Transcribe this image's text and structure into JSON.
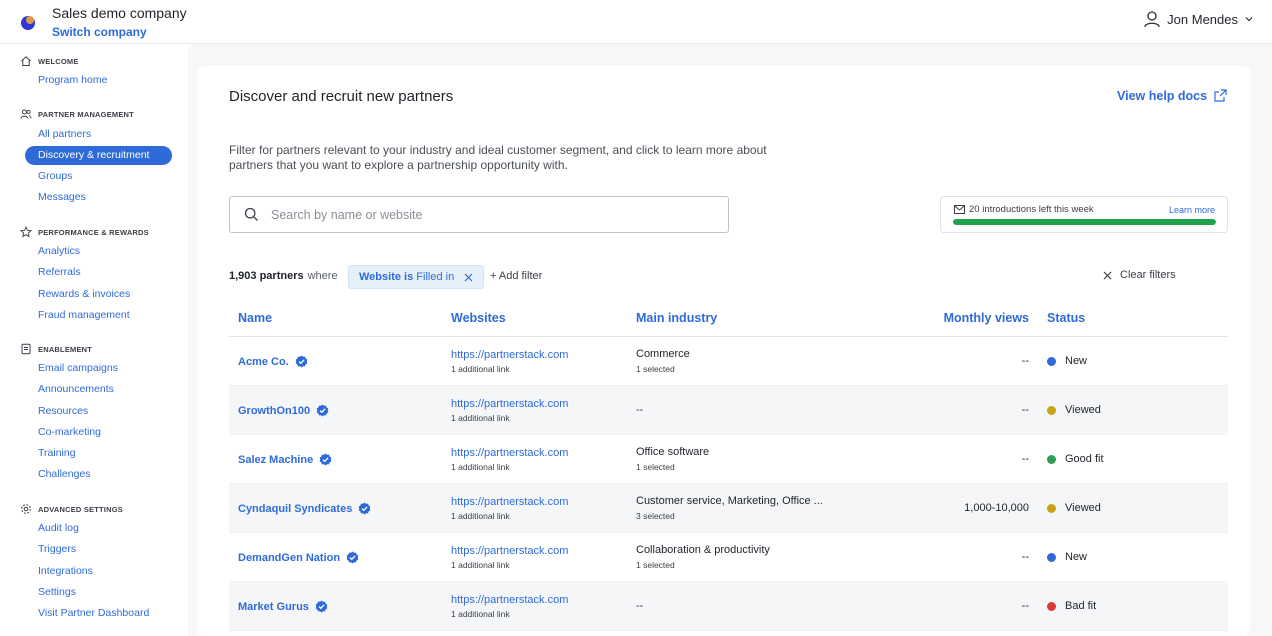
{
  "topbar": {
    "company": "Sales demo company",
    "switch_label": "Switch company",
    "user_name": "Jon Mendes"
  },
  "sidebar": {
    "sections": [
      {
        "label": "WELCOME",
        "icon": "home-icon",
        "items": [
          "Program home"
        ]
      },
      {
        "label": "PARTNER MANAGEMENT",
        "icon": "users-icon",
        "items": [
          "All partners",
          "Discovery & recruitment",
          "Groups",
          "Messages"
        ]
      },
      {
        "label": "PERFORMANCE & REWARDS",
        "icon": "star-icon",
        "items": [
          "Analytics",
          "Referrals",
          "Rewards & invoices",
          "Fraud management"
        ]
      },
      {
        "label": "ENABLEMENT",
        "icon": "document-icon",
        "items": [
          "Email campaigns",
          "Announcements",
          "Resources",
          "Co-marketing",
          "Training",
          "Challenges"
        ]
      },
      {
        "label": "ADVANCED SETTINGS",
        "icon": "gear-icon",
        "items": [
          "Audit log",
          "Triggers",
          "Integrations",
          "Settings",
          "Visit Partner Dashboard"
        ]
      }
    ],
    "active_item": "Discovery & recruitment"
  },
  "main": {
    "title": "Discover and recruit new partners",
    "help_link": "View help docs",
    "description": "Filter for partners relevant to your industry and ideal customer segment, and click to learn more about partners that you want to explore a partnership opportunity with.",
    "search_placeholder": "Search by name or website",
    "intro": {
      "text": "20 introductions left this week",
      "learn_more": "Learn more",
      "progress": 1.0
    },
    "count": "1,903 partners",
    "where": "where",
    "filter": {
      "key": "Website",
      "op": "is",
      "value": "Filled in"
    },
    "add_filter": "+ Add filter",
    "clear_filters": "Clear filters",
    "columns": [
      "Name",
      "Websites",
      "Main industry",
      "Monthly views",
      "Status"
    ],
    "rows": [
      {
        "name": "Acme Co.",
        "website": "https://partnerstack.com",
        "more": "1 additional link",
        "industry": "Commerce",
        "ind_sub": "1 selected",
        "views": "--",
        "status": "New",
        "status_color": "#2f6bd8"
      },
      {
        "name": "GrowthOn100",
        "website": "https://partnerstack.com",
        "more": "1 additional link",
        "industry": "",
        "ind_sub": "--",
        "views": "--",
        "status": "Viewed",
        "status_color": "#c9a218"
      },
      {
        "name": "Salez Machine",
        "website": "https://partnerstack.com",
        "more": "1 additional link",
        "industry": "Office software",
        "ind_sub": "1 selected",
        "views": "--",
        "status": "Good fit",
        "status_color": "#2e9e57"
      },
      {
        "name": "Cyndaquil Syndicates",
        "website": "https://partnerstack.com",
        "more": "1 additional link",
        "industry": "Customer service, Marketing, Office ...",
        "ind_sub": "3 selected",
        "views": "1,000-10,000",
        "status": "Viewed",
        "status_color": "#c9a218"
      },
      {
        "name": "DemandGen Nation",
        "website": "https://partnerstack.com",
        "more": "1 additional link",
        "industry": "Collaboration & productivity",
        "ind_sub": "1 selected",
        "views": "--",
        "status": "New",
        "status_color": "#2f6bd8"
      },
      {
        "name": "Market Gurus",
        "website": "https://partnerstack.com",
        "more": "1 additional link",
        "industry": "",
        "ind_sub": "--",
        "views": "--",
        "status": "Bad fit",
        "status_color": "#d93a3a"
      }
    ]
  }
}
